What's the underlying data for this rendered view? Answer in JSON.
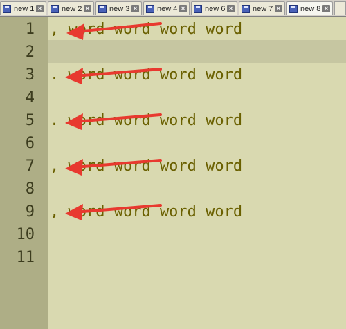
{
  "tabs": [
    {
      "label": "new 1"
    },
    {
      "label": "new 2"
    },
    {
      "label": "new 3"
    },
    {
      "label": "new 4"
    },
    {
      "label": "new 6"
    },
    {
      "label": "new 7"
    },
    {
      "label": "new 8"
    }
  ],
  "editor": {
    "line_numbers": [
      "1",
      "2",
      "3",
      "4",
      "5",
      "6",
      "7",
      "8",
      "9",
      "10",
      "11"
    ],
    "lines": [
      ", word word word word",
      "",
      ". word word word word",
      "",
      ". word word word word",
      "",
      ", word word word word",
      "",
      ", word word word word",
      "",
      ""
    ],
    "current_line": 2
  },
  "annotations": {
    "arrow_color": "#e8392f",
    "arrow_count": 5
  },
  "colors": {
    "text": "#6a6000",
    "background": "#d9d9b0",
    "gutter": "#aeae86",
    "current_line": "#c6c6a1"
  }
}
